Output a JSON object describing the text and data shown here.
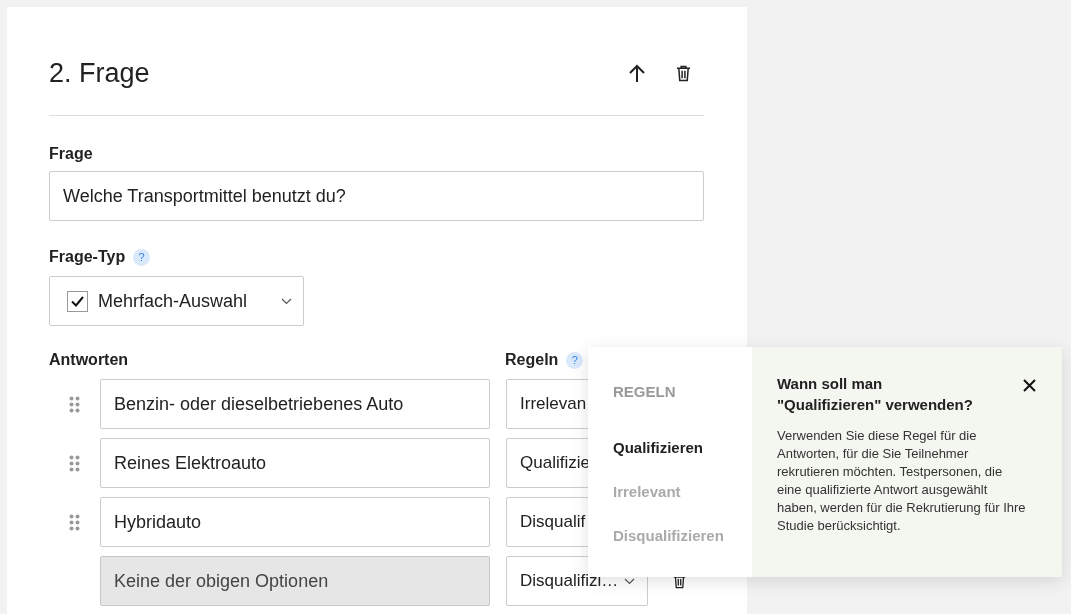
{
  "question": {
    "title": "2. Frage",
    "field_label": "Frage",
    "text": "Welche Transportmittel benutzt du?",
    "type_label": "Frage-Typ",
    "type_value": "Mehrfach-Auswahl",
    "type_checked": true,
    "type_help": "?"
  },
  "rules_help": "?",
  "answers_label": "Antworten",
  "rules_label": "Regeln",
  "answers": [
    {
      "text": "Benzin- oder dieselbetriebenes Auto",
      "rule": "Irrelevan",
      "disabled": false
    },
    {
      "text": "Reines Elektroauto",
      "rule": "Qualifizie",
      "disabled": false
    },
    {
      "text": "Hybridauto",
      "rule": "Disqualif",
      "disabled": false
    },
    {
      "text": "Keine der obigen Optionen",
      "rule": "Disqualifizi…",
      "disabled": true
    }
  ],
  "popover": {
    "heading": "REGELN",
    "options": [
      {
        "label": "Qualifizieren",
        "selected": true
      },
      {
        "label": "Irrelevant",
        "selected": false
      },
      {
        "label": "Disqualifizieren",
        "selected": false
      }
    ],
    "title": "Wann soll man\n\"Qualifizieren\" verwenden?",
    "body": "Verwenden Sie diese Regel für die Antworten, für die Sie Teilnehmer rekrutieren möchten. Testpersonen, die eine qualifizierte Antwort ausgewählt haben, werden für die Rekrutierung für Ihre Studie berücksichtigt."
  }
}
